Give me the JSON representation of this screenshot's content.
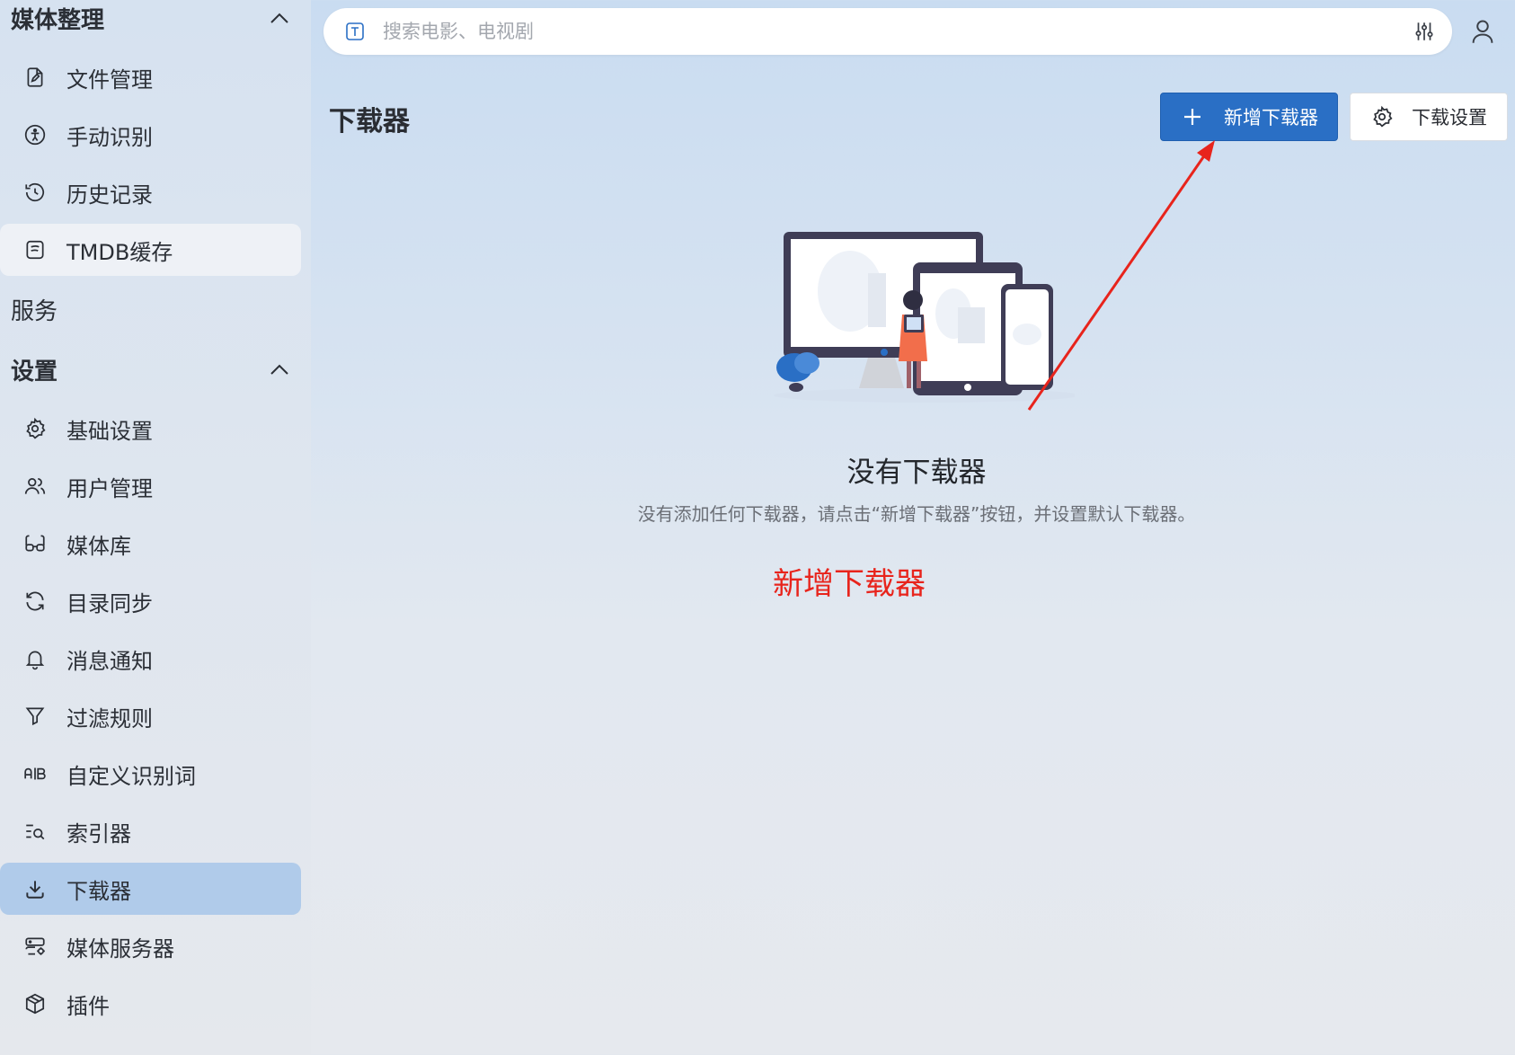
{
  "sidebar": {
    "groups": {
      "media": {
        "label": "媒体整理"
      },
      "services": {
        "label": "服务"
      },
      "settings": {
        "label": "设置"
      }
    },
    "media_items": [
      {
        "label": "文件管理",
        "icon": "file-edit-icon"
      },
      {
        "label": "手动识别",
        "icon": "accessibility-icon"
      },
      {
        "label": "历史记录",
        "icon": "history-icon"
      },
      {
        "label": "TMDB缓存",
        "icon": "cache-icon"
      }
    ],
    "settings_items": [
      {
        "label": "基础设置",
        "icon": "gear-icon"
      },
      {
        "label": "用户管理",
        "icon": "users-icon"
      },
      {
        "label": "媒体库",
        "icon": "glasses-icon"
      },
      {
        "label": "目录同步",
        "icon": "refresh-icon"
      },
      {
        "label": "消息通知",
        "icon": "bell-icon"
      },
      {
        "label": "过滤规则",
        "icon": "filter-icon"
      },
      {
        "label": "自定义识别词",
        "icon": "ab-icon"
      },
      {
        "label": "索引器",
        "icon": "list-search-icon"
      },
      {
        "label": "下载器",
        "icon": "download-icon"
      },
      {
        "label": "媒体服务器",
        "icon": "server-cog-icon"
      },
      {
        "label": "插件",
        "icon": "package-icon"
      }
    ],
    "active_item": "下载器"
  },
  "search": {
    "placeholder": "搜索电影、电视剧",
    "value": ""
  },
  "page": {
    "title": "下载器",
    "add_button": "新增下载器",
    "settings_button": "下载设置"
  },
  "empty_state": {
    "title": "没有下载器",
    "description": "没有添加任何下载器，请点击“新增下载器”按钮，并设置默认下载器。"
  },
  "annotation": {
    "text": "新增下载器",
    "color": "#e8241c"
  },
  "colors": {
    "primary": "#2a6fc5",
    "active_nav": "#b0cbea",
    "annotation": "#e8241c"
  }
}
